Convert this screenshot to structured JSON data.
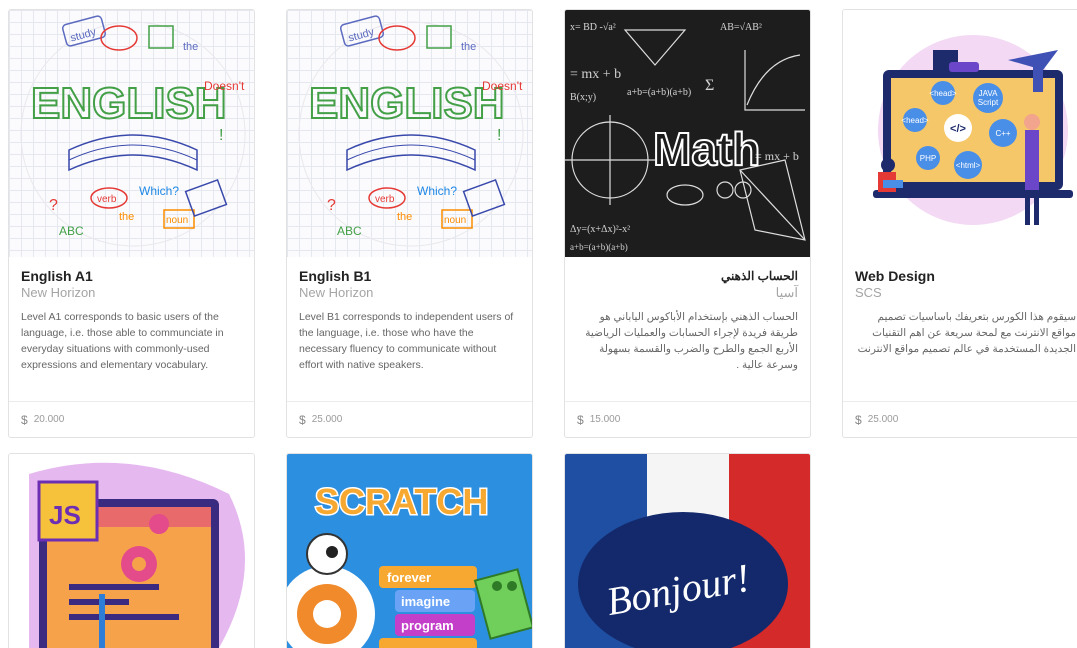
{
  "courses": [
    {
      "title": "English A1",
      "provider": "New Horizon",
      "description": "Level A1 corresponds to basic users of the language, i.e. those able to communciate in everyday situations with commonly-used expressions and elementary vocabulary.",
      "currency": "$",
      "price": "20.000",
      "image": "english-doodle-illustration"
    },
    {
      "title": "English B1",
      "provider": "New Horizon",
      "description": "Level B1 corresponds to independent users of the language, i.e. those who have the necessary fluency to communicate without effort with native speakers.",
      "currency": "$",
      "price": "25.000",
      "image": "english-doodle-illustration"
    },
    {
      "title": "الحساب الذهني",
      "provider": "آسيا",
      "description": "الحساب الذهني بإستخدام الأباكوس الياباني هو طريقة فريدة لإجراء الحسابات والعمليات الرياضية الأربع الجمع والطرح والضرب والقسمة بسهولة وسرعة عالية .",
      "currency": "$",
      "price": "15.000",
      "image": "math-chalkboard",
      "image_text": "Math"
    },
    {
      "title": "Web Design",
      "provider": "SCS",
      "description": "سيقوم هذا الكورس بتعريفك باساسيات تصميم مواقع الانترنت مع لمحة سريعة عن اهم التقنيات الجديدة المستخدمة في عالم تصميم مواقع الانترنت",
      "currency": "$",
      "price": "25.000",
      "image": "web-design-illustration",
      "image_tags": [
        "<head>",
        "JAVA Script",
        "<head>",
        "</>",
        "C++",
        "PHP",
        "<html>"
      ]
    }
  ],
  "courses_row2": [
    {
      "image": "javascript-illustration",
      "image_text": "JS"
    },
    {
      "image": "scratch-illustration",
      "image_text": "SCRATCH",
      "blocks": [
        "forever",
        "imagine",
        "program"
      ]
    },
    {
      "image": "bonjour-illustration",
      "image_text": "Bonjour!"
    }
  ],
  "colors": {
    "scratch_blue": "#2c8fe0",
    "french_blue": "#1e4fa3",
    "french_red": "#d42a2a"
  }
}
